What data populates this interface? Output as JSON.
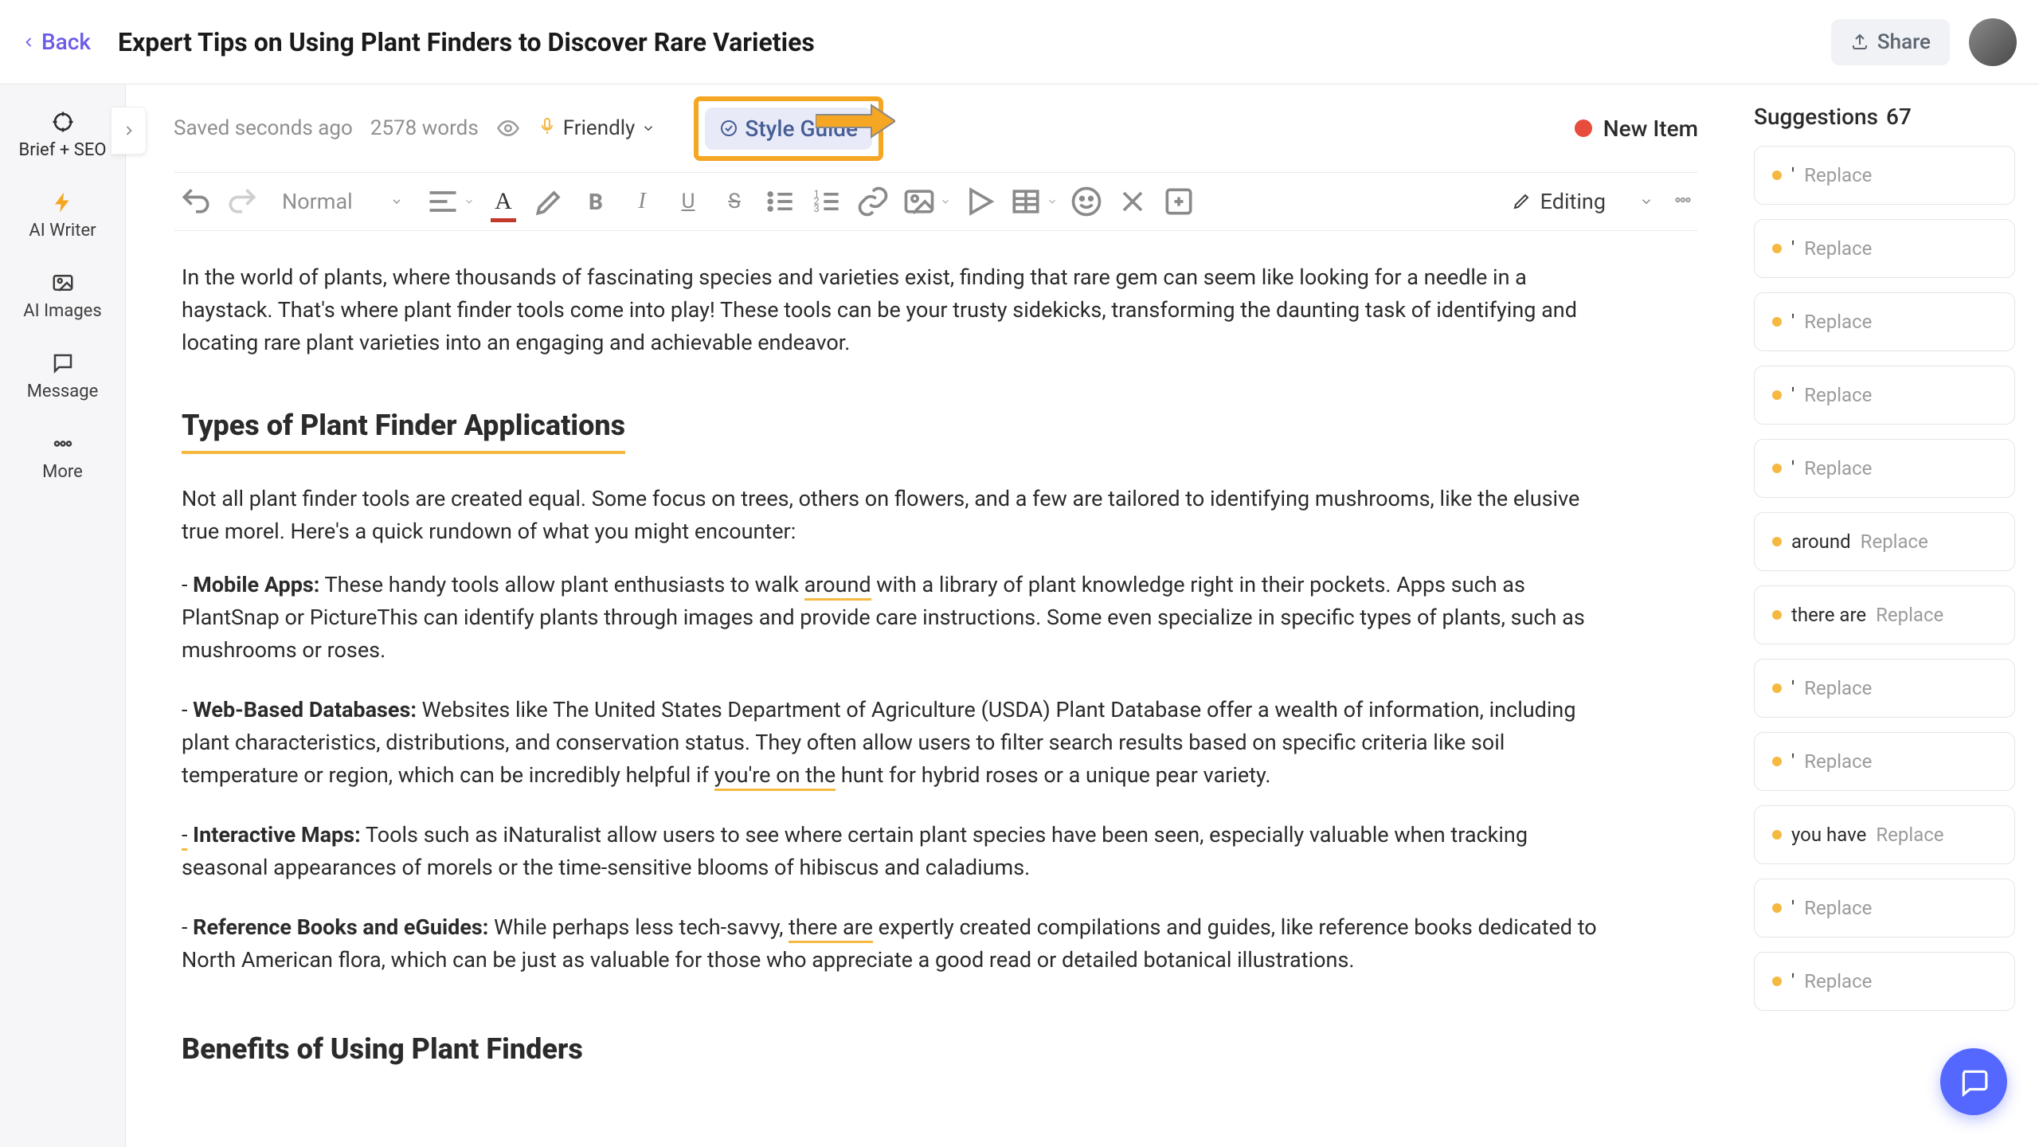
{
  "header": {
    "back_label": "Back",
    "title": "Expert Tips on Using Plant Finders to Discover Rare Varieties",
    "share_label": "Share"
  },
  "sidebar": {
    "items": [
      {
        "label": "Brief + SEO",
        "icon": "target-icon"
      },
      {
        "label": "AI Writer",
        "icon": "bolt-icon"
      },
      {
        "label": "AI Images",
        "icon": "image-icon"
      },
      {
        "label": "Message",
        "icon": "chat-icon"
      },
      {
        "label": "More",
        "icon": "more-icon"
      }
    ]
  },
  "meta": {
    "saved": "Saved seconds ago",
    "word_count": "2578 words",
    "tone_label": "Friendly",
    "style_guide_label": "Style Guide",
    "new_item_label": "New Item"
  },
  "toolbar": {
    "style_sel": "Normal",
    "editing_label": "Editing"
  },
  "content": {
    "intro": "In the world of plants, where thousands of fascinating species and varieties exist, finding that rare gem can seem like looking for a needle in a haystack. That's where plant finder tools come into play! These tools can be your trusty sidekicks, transforming the daunting task of identifying and locating rare plant varieties into an engaging and achievable endeavor.",
    "h2": "Types of Plant Finder Applications",
    "p2": "Not all plant finder tools are created equal. Some focus on trees, others on flowers, and a few are tailored to identifying mushrooms, like the elusive true morel. Here's a quick rundown of what you might encounter:",
    "li1_b": "Mobile Apps:",
    "li1_a": " These handy tools allow plant enthusiasts to walk ",
    "li1_hl": "around",
    "li1_c": " with a library of plant knowledge right in their pockets. Apps such as PlantSnap or PictureThis can identify plants through images and provide care instructions. Some even specialize in specific types of plants, such as mushrooms or roses.",
    "li2_b": "Web-Based Databases:",
    "li2_a": " Websites like The United States Department of Agriculture (USDA) Plant Database offer a wealth of information, including plant characteristics, distributions, and conservation status. They often allow users to filter search results based on specific criteria like soil temperature or region, which can be incredibly helpful if ",
    "li2_hl": "you're on the",
    "li2_c": " hunt for hybrid roses or a unique pear variety.",
    "li3_b": "Interactive Maps:",
    "li3_a": " Tools such as iNaturalist allow users to see where certain plant species have been seen, especially valuable when tracking seasonal appearances of morels or the time-sensitive blooms of hibiscus and caladiums.",
    "li4_b": "Reference Books and eGuides:",
    "li4_a": " While perhaps less tech-savvy, ",
    "li4_hl": "there are",
    "li4_c": " expertly created compilations and guides, like reference books dedicated to North American flora, which can be just as valuable for those who appreciate a good read or detailed botanical illustrations.",
    "h2b": "Benefits of Using Plant Finders"
  },
  "suggestions": {
    "title": "Suggestions",
    "count": "67",
    "items": [
      {
        "word": "'",
        "action": "Replace"
      },
      {
        "word": "'",
        "action": "Replace"
      },
      {
        "word": "'",
        "action": "Replace"
      },
      {
        "word": "'",
        "action": "Replace"
      },
      {
        "word": "'",
        "action": "Replace"
      },
      {
        "word": "around",
        "action": "Replace"
      },
      {
        "word": "there are",
        "action": "Replace"
      },
      {
        "word": "'",
        "action": "Replace"
      },
      {
        "word": "'",
        "action": "Replace"
      },
      {
        "word": "you have",
        "action": "Replace"
      },
      {
        "word": "'",
        "action": "Replace"
      },
      {
        "word": "'",
        "action": "Replace"
      }
    ]
  }
}
